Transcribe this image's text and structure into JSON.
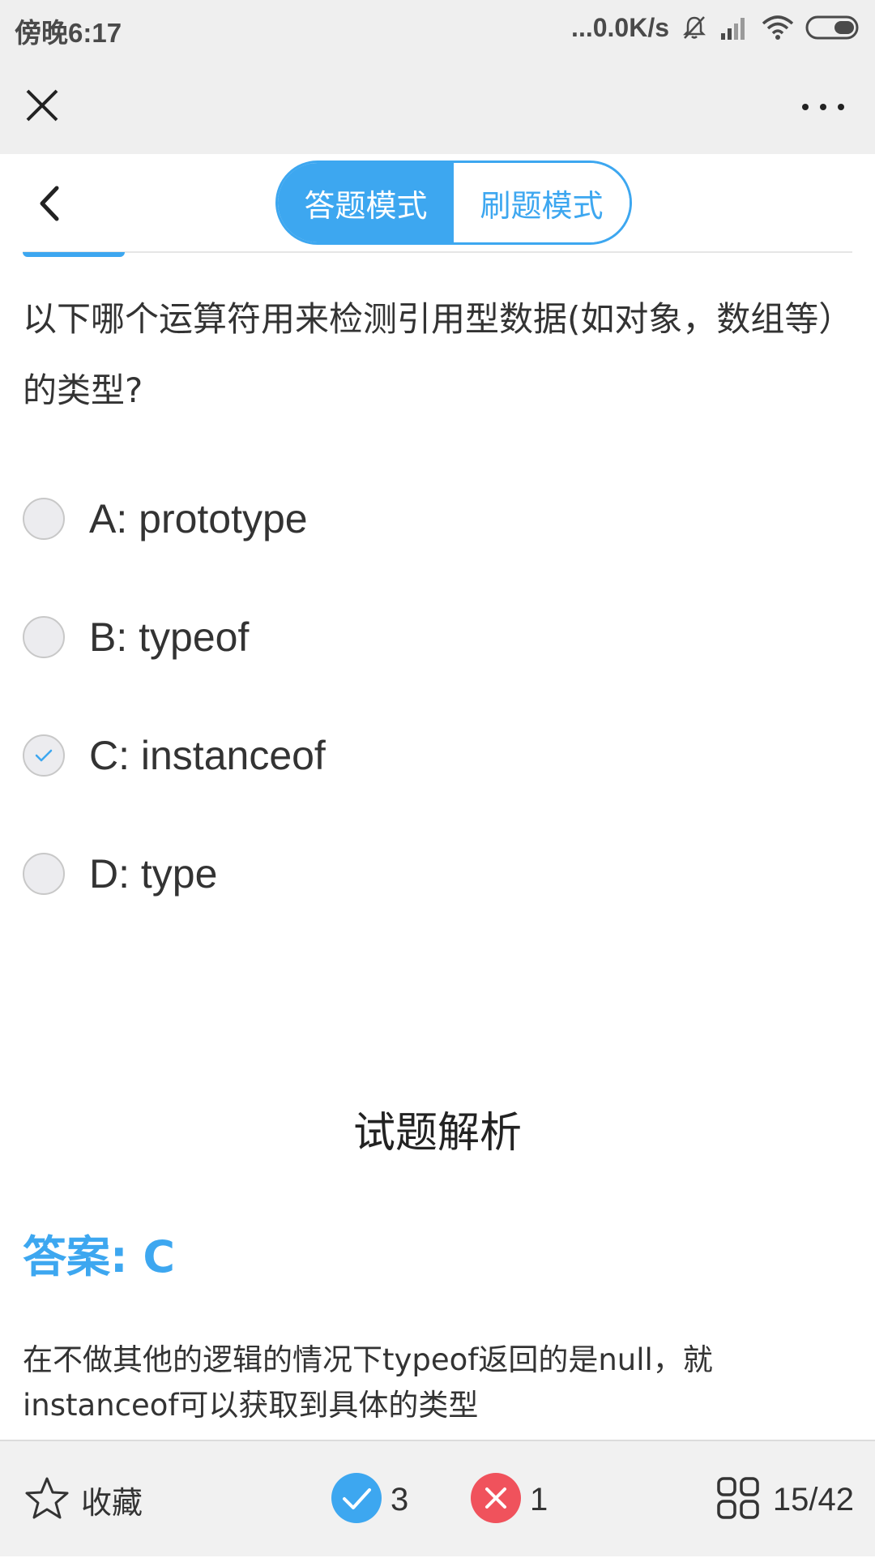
{
  "status_bar": {
    "time": "傍晚6:17",
    "network_speed": "...0.0K/s",
    "icons": [
      "mute-bell-icon",
      "signal-icon",
      "wifi-icon",
      "battery-icon"
    ]
  },
  "nav": {
    "close_icon": "close-icon",
    "more_icon": "more-icon"
  },
  "mode_toggle": {
    "active": "答题模式",
    "inactive": "刷题模式"
  },
  "question": {
    "text": "以下哪个运算符用来检测引用型数据(如对象，数组等）的类型?",
    "options": [
      {
        "label": "A: prototype",
        "selected": false
      },
      {
        "label": "B: typeof",
        "selected": false
      },
      {
        "label": "C: instanceof",
        "selected": true
      },
      {
        "label": "D: type",
        "selected": false
      }
    ]
  },
  "analysis": {
    "title": "试题解析",
    "answer": "答案: C",
    "explanation": "在不做其他的逻辑的情况下typeof返回的是null，就instanceof可以获取到具体的类型"
  },
  "bottom_bar": {
    "favorite_label": "收藏",
    "correct_count": "3",
    "wrong_count": "1",
    "progress": "15/42"
  },
  "colors": {
    "accent": "#3da7f0",
    "wrong": "#f0525c",
    "bar_bg": "#efefef"
  }
}
